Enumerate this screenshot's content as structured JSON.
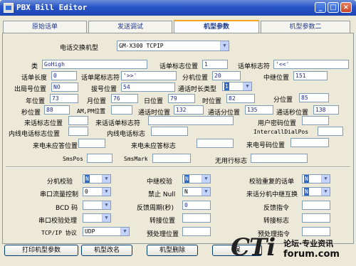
{
  "window": {
    "title": "PBX Bill Editor"
  },
  "tabs": [
    "原始话单",
    "发送调试",
    "机型参数",
    "机型参数二"
  ],
  "model": {
    "label": "电话交换机型",
    "value": "GM-X300 TCPIP"
  },
  "fields": {
    "type_label": "类",
    "type_value": "GoHigh",
    "record_pos_label": "话单标志位置",
    "record_pos_value": "1",
    "record_flag_label": "话单标志符",
    "record_flag_value": "'<<'",
    "length_label": "话单长度",
    "length_value": "0",
    "tail_flag_label": "话单尾标志符",
    "tail_flag_value": "'>>'",
    "ext_pos_label": "分机位置",
    "ext_pos_value": "20",
    "trunk_pos_label": "中继位置",
    "trunk_pos_value": "151",
    "outflag_pos_label": "出局号位置",
    "outflag_pos_value": "NO",
    "dial_pos_label": "拔号位置",
    "dial_pos_value": "54",
    "duration_type_label": "通话时长类型",
    "duration_type_value": "1",
    "year_label": "年位置",
    "year_value": "73",
    "month_label": "月位置",
    "month_value": "76",
    "day_label": "日位置",
    "day_value": "79",
    "hour_label": "时位置",
    "hour_value": "82",
    "minute_label": "分位置",
    "minute_value": "85",
    "second_label": "秒位置",
    "second_value": "88",
    "ampm_label": "AM,PM位置",
    "ampm_value": "",
    "talk_hour_label": "通话时位置",
    "talk_hour_value": "132",
    "talk_min_label": "通话分位置",
    "talk_min_value": "135",
    "talk_sec_label": "通话秒位置",
    "talk_sec_value": "138",
    "incoming_flag_pos_label": "来话标志位置",
    "incoming_flag_pos_value": "",
    "incoming_flag_label": "来话话单标志符",
    "incoming_flag_value": "",
    "user_pwd_pos_label": "用户密码位置",
    "user_pwd_pos_value": "",
    "internal_flag_pos_label": "内线电话标志位置",
    "internal_flag_pos_value": "",
    "internal_flag_label": "内线电话标志",
    "internal_flag_value": "",
    "intercall_label": "IntercallDialPos",
    "intercall_value": "",
    "incoming_unanswered_pos_label": "来电未应答位置",
    "incoming_unanswered_pos_value": "",
    "incoming_unanswered_flag_label": "来电未应答标志",
    "incoming_unanswered_flag_value": "",
    "caller_no_pos_label": "来电号码位置",
    "caller_no_pos_value": "",
    "smspos_label": "SmsPos",
    "smspos_value": "",
    "smsmark_label": "SmsMark",
    "smsmark_value": "",
    "useless_label": "无用行标志",
    "useless_value": ""
  },
  "options": {
    "ext_check_label": "分机校验",
    "ext_check_value": "N",
    "trunk_check_label": "中继校验",
    "trunk_check_value": "N",
    "dup_check_label": "校验重复的话单",
    "dup_check_value": "N",
    "flow_label": "串口流量控制",
    "flow_value": "0",
    "null_label": "禁止 Null",
    "null_value": "N",
    "swap_label": "来话分机中继互换",
    "swap_value": "N",
    "bcd_label": "BCD 码",
    "bcd_value": "",
    "period_label": "反馈周期(秒)",
    "period_value": "0",
    "feedback_label": "反馈指令",
    "feedback_value": "",
    "serial_check_label": "串口校验处理",
    "serial_check_value": "",
    "convert_pos_label": "转接位置",
    "convert_pos_value": "",
    "convert_flag_label": "转接标志",
    "convert_flag_value": "",
    "protocol_label": "TCP/IP 协议",
    "protocol_value": "UDP",
    "prehandle_pos_label": "预处理位置",
    "prehandle_pos_value": "",
    "prehandle_cmd_label": "预处理指令",
    "prehandle_cmd_value": ""
  },
  "buttons": {
    "print": "打印机型参数",
    "rename": "机型改名",
    "delete": "机型删除",
    "save": "保"
  },
  "watermark": {
    "main": "CTi",
    "top": "论坛·专业资讯",
    "bottom": "forum.com"
  }
}
